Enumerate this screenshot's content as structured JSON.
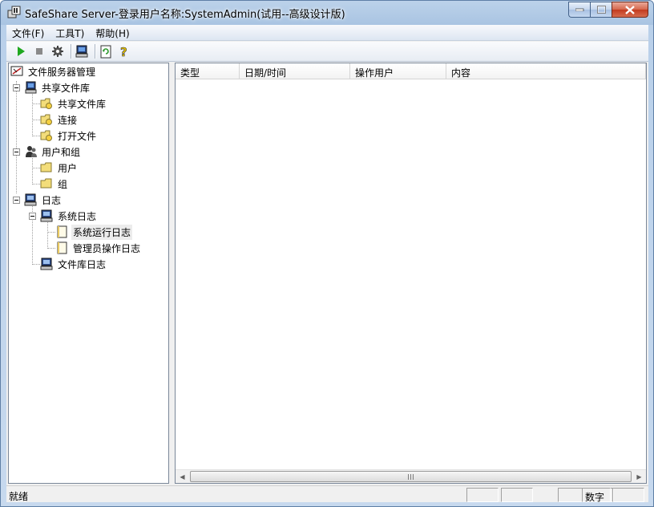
{
  "window": {
    "title": "SafeShare Server-登录用户名称:SystemAdmin(试用--高级设计版)"
  },
  "menu": {
    "items": [
      {
        "label": "文件(F)"
      },
      {
        "label": "工具T)"
      },
      {
        "label": "帮助(H)"
      }
    ]
  },
  "toolbar": {
    "buttons": [
      {
        "icon": "play-icon",
        "color": "#1fa81f"
      },
      {
        "icon": "stop-icon",
        "color": "#8a8a8a"
      },
      {
        "icon": "settings-gear-icon"
      },
      {
        "icon": "computer-icon"
      },
      {
        "icon": "refresh-document-icon",
        "color": "#2e9a2e"
      },
      {
        "icon": "help-icon",
        "color": "#e6c200"
      }
    ]
  },
  "tree": {
    "root": "文件服务器管理",
    "shared": {
      "label": "共享文件库",
      "children": [
        "共享文件库",
        "连接",
        "打开文件"
      ]
    },
    "users": {
      "label": "用户和组",
      "children": [
        "用户",
        "组"
      ]
    },
    "logs": {
      "label": "日志",
      "system_log": {
        "label": "系统日志",
        "children": [
          "系统运行日志",
          "管理员操作日志"
        ]
      },
      "library_log": "文件库日志"
    }
  },
  "list": {
    "columns": [
      "类型",
      "日期/时间",
      "操作用户",
      "内容"
    ],
    "rows": []
  },
  "status": {
    "text": "就绪",
    "num_indicator": "数字"
  },
  "colors": {
    "folder": "#f3dd7a",
    "title_bar": "#b9d0ea",
    "close_button": "#c8452b"
  }
}
